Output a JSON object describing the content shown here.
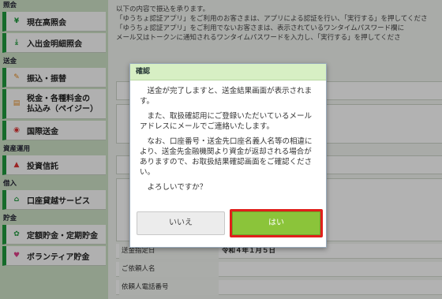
{
  "sidebar": {
    "sections": [
      {
        "heading": "照会",
        "items": [
          {
            "label": "現在高照会",
            "icon": "yen-icon"
          },
          {
            "label": "入出金明細照会",
            "icon": "download-icon"
          }
        ]
      },
      {
        "heading": "送金",
        "items": [
          {
            "label": "振込・振替",
            "icon": "pen-icon"
          },
          {
            "label": "税金・各種料金の",
            "label2": "払込み（ペイジー）",
            "icon": "pay-icon"
          },
          {
            "label": "国際送金",
            "icon": "globe-icon"
          }
        ]
      },
      {
        "heading": "資産運用",
        "items": [
          {
            "label": "投資信託",
            "icon": "grad-cap-icon"
          }
        ]
      },
      {
        "heading": "借入",
        "items": [
          {
            "label": "口座貸越サービス",
            "icon": "bank-icon"
          }
        ]
      },
      {
        "heading": "貯金",
        "items": [
          {
            "label": "定額貯金・定期貯金",
            "icon": "sprout-icon"
          },
          {
            "label": "ボランティア貯金",
            "icon": "heart-icon"
          }
        ]
      }
    ]
  },
  "main": {
    "intro_lines": [
      "以下の内容で振込を承ります。",
      "「ゆうちょ認証アプリ」をご利用のお客さまは、アプリによる認証を行い、「実行する」を押してくださ",
      "「ゆうちょ認証アプリ」をご利用でないお客さまは、表示されているワンタイムパスワード欄に",
      "メール又はトークンに通知されるワンタイムパスワードを入力し、「実行する」を押してくださ"
    ],
    "rows": [
      {
        "label": "送金指定日",
        "value": "令和４年１月５日"
      },
      {
        "label": "ご依頼人名",
        "value": ""
      },
      {
        "label": "依頼人電話番号",
        "value": ""
      }
    ]
  },
  "dialog": {
    "title": "確認",
    "paragraphs": [
      "送金が完了しますと、送金結果画面が表示されます。",
      "また、取扱確認用にご登録いただいているメールアドレスにメールでご連絡いたします。",
      "なお、口座番号・送金先口座名義人名等の相違により、送金先金融機関より資金が返却される場合がありますので、お取扱結果確認画面をご確認ください。",
      "よろしいですか？"
    ],
    "no_label": "いいえ",
    "yes_label": "はい"
  },
  "colors": {
    "accent": "#1f9a3d",
    "yes_button": "#8bc43a",
    "highlight": "#e0201c",
    "title_bg": "#d7efc4"
  }
}
